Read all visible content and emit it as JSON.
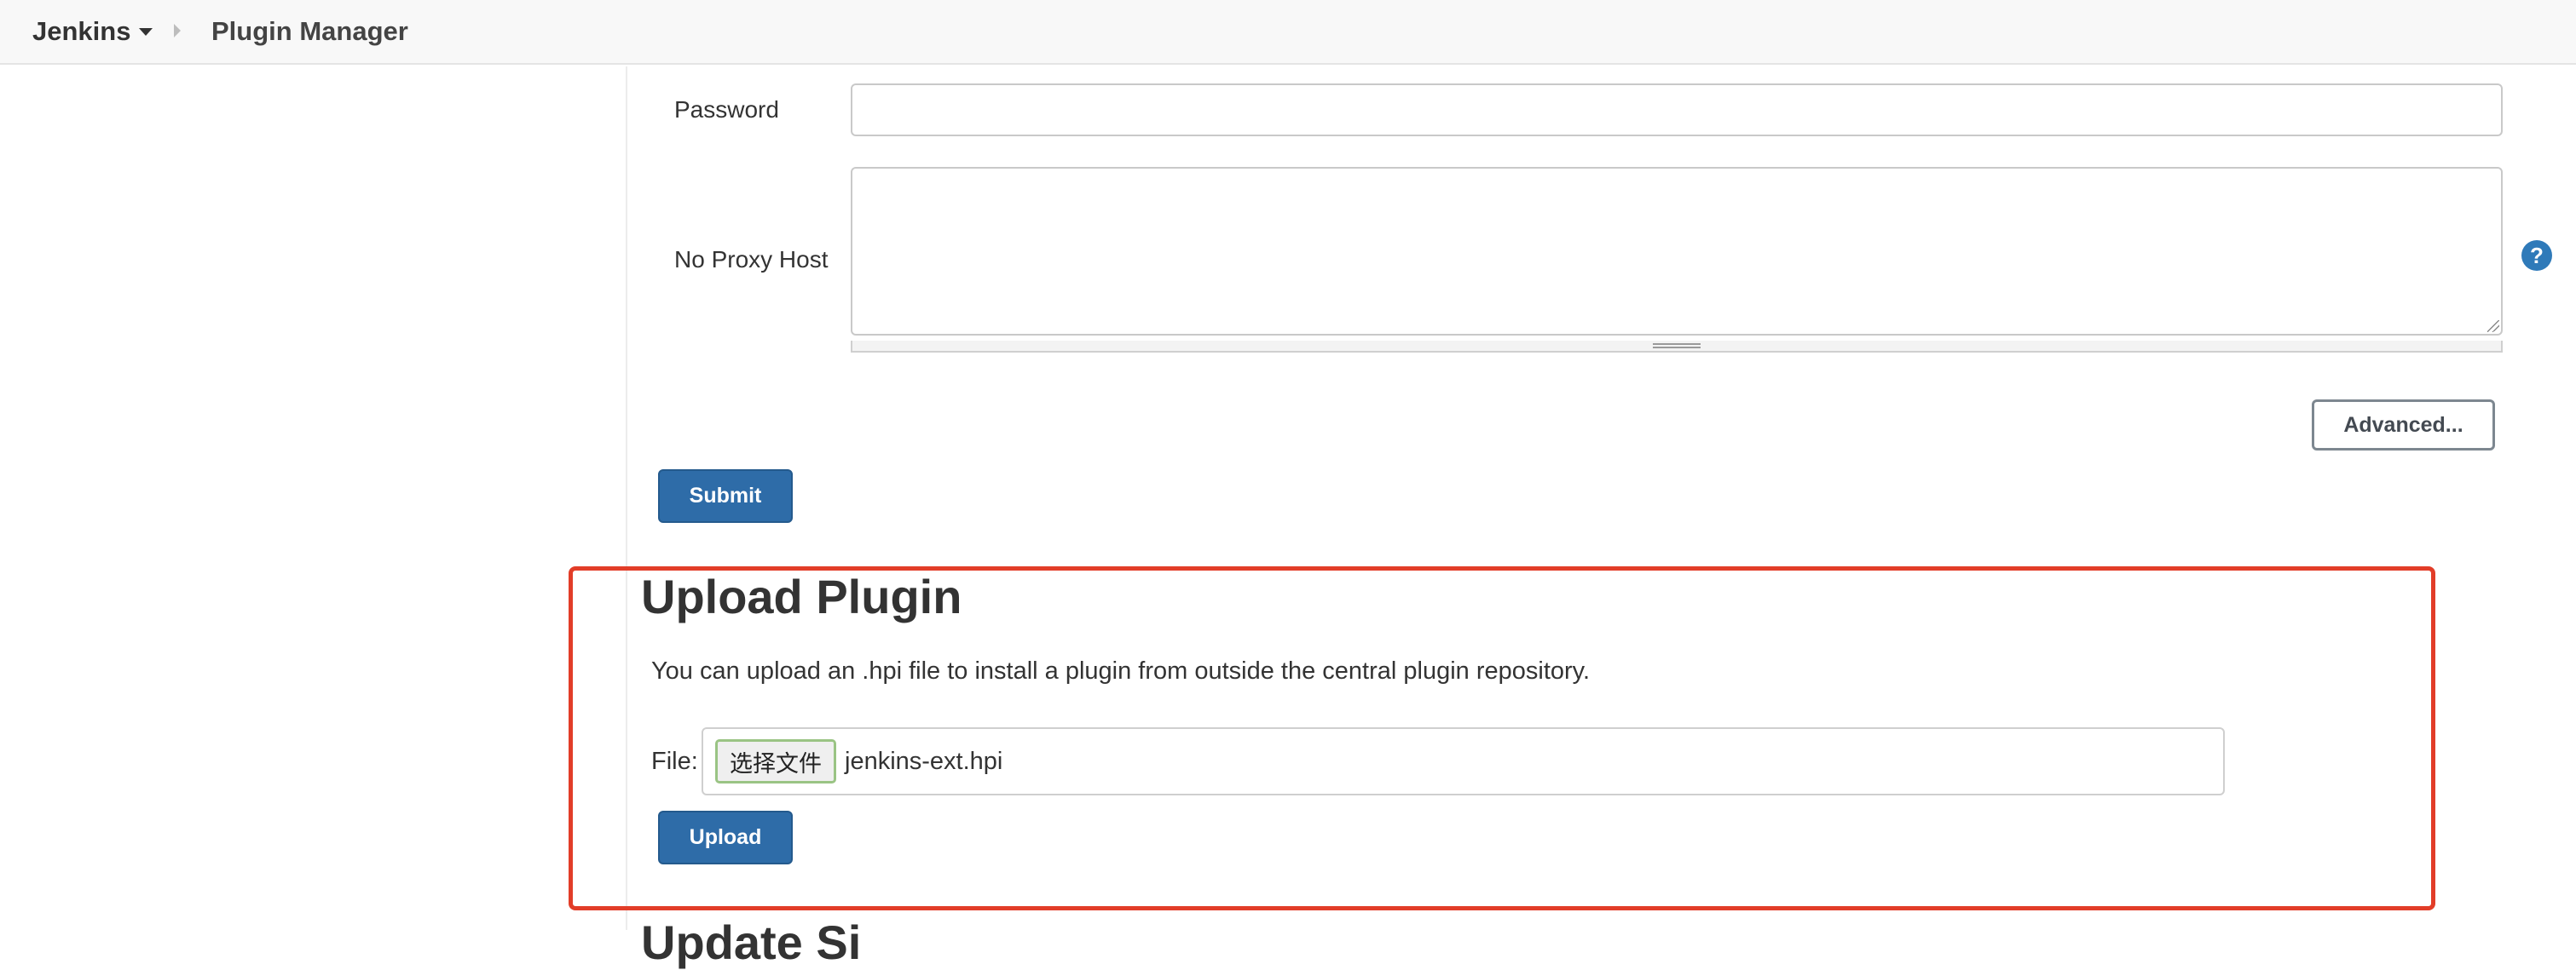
{
  "breadcrumb": {
    "root": "Jenkins",
    "current": "Plugin Manager"
  },
  "proxy": {
    "password_label": "Password",
    "password_value": "",
    "no_proxy_label": "No Proxy Host",
    "no_proxy_value": "",
    "help_icon_glyph": "?",
    "advanced_label": "Advanced...",
    "submit_label": "Submit"
  },
  "upload": {
    "title": "Upload Plugin",
    "description": "You can upload an .hpi file to install a plugin from outside the central plugin repository.",
    "file_label": "File:",
    "choose_file_label": "选择文件",
    "file_name": "jenkins-ext.hpi",
    "upload_label": "Upload"
  },
  "next_section": {
    "title": "Update Si"
  },
  "colors": {
    "primary_button": "#2e6ca8",
    "highlight_border": "#e23d28",
    "help_icon": "#2f7ab9",
    "breadcrumb_bg": "#f8f8f8"
  }
}
